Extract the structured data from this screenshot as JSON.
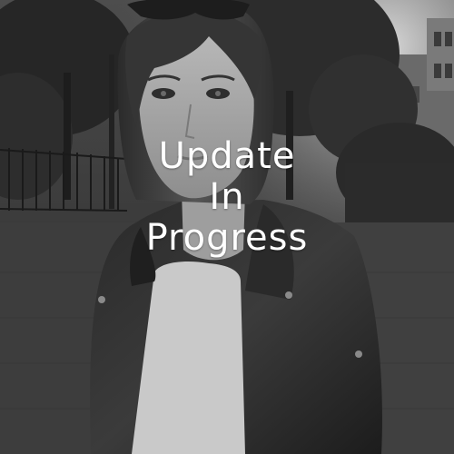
{
  "status_overlay": {
    "lines": [
      "Update",
      "In",
      "Progress"
    ]
  }
}
